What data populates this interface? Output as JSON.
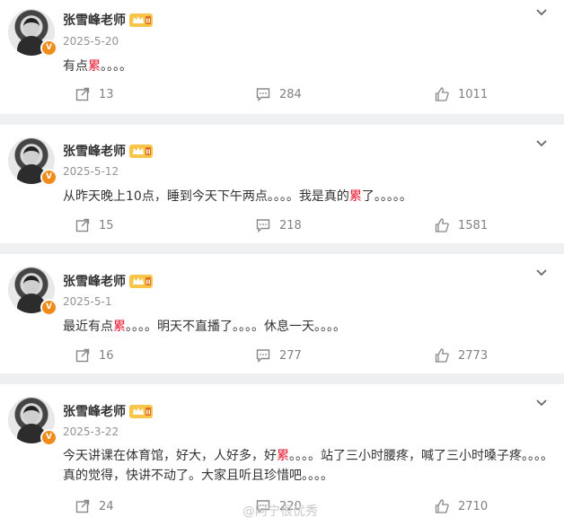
{
  "posts": [
    {
      "name": "张雪峰老师",
      "date": "2025-5-20",
      "text_parts": [
        "有点",
        "累",
        "。。。。"
      ],
      "reposts": "13",
      "comments": "284",
      "likes": "1011"
    },
    {
      "name": "张雪峰老师",
      "date": "2025-5-12",
      "text_parts": [
        "从昨天晚上10点，睡到今天下午两点。。。。我是真的",
        "累",
        "了。。。。。"
      ],
      "reposts": "15",
      "comments": "218",
      "likes": "1581"
    },
    {
      "name": "张雪峰老师",
      "date": "2025-5-1",
      "text_parts": [
        "最近有点",
        "累",
        "。。。。明天不直播了。。。。休息一天。。。。"
      ],
      "reposts": "16",
      "comments": "277",
      "likes": "2773"
    },
    {
      "name": "张雪峰老师",
      "date": "2025-3-22",
      "text_parts": [
        "今天讲课在体育馆，好大，人好多，好",
        "累",
        "。。。。站了三小时腰疼，喊了三小时嗓子疼。。。。真的觉得，快讲不动了。大家且听且珍惜吧。。。。"
      ],
      "reposts": "24",
      "comments": "220",
      "likes": "2710"
    }
  ],
  "watermark": "@阿宁很优秀",
  "colors": {
    "highlight": "#e6162d",
    "verified": "#f08a18"
  },
  "icons": [
    "repost-icon",
    "comment-icon",
    "like-icon",
    "chevron-down-icon",
    "vip-crown-icon"
  ]
}
